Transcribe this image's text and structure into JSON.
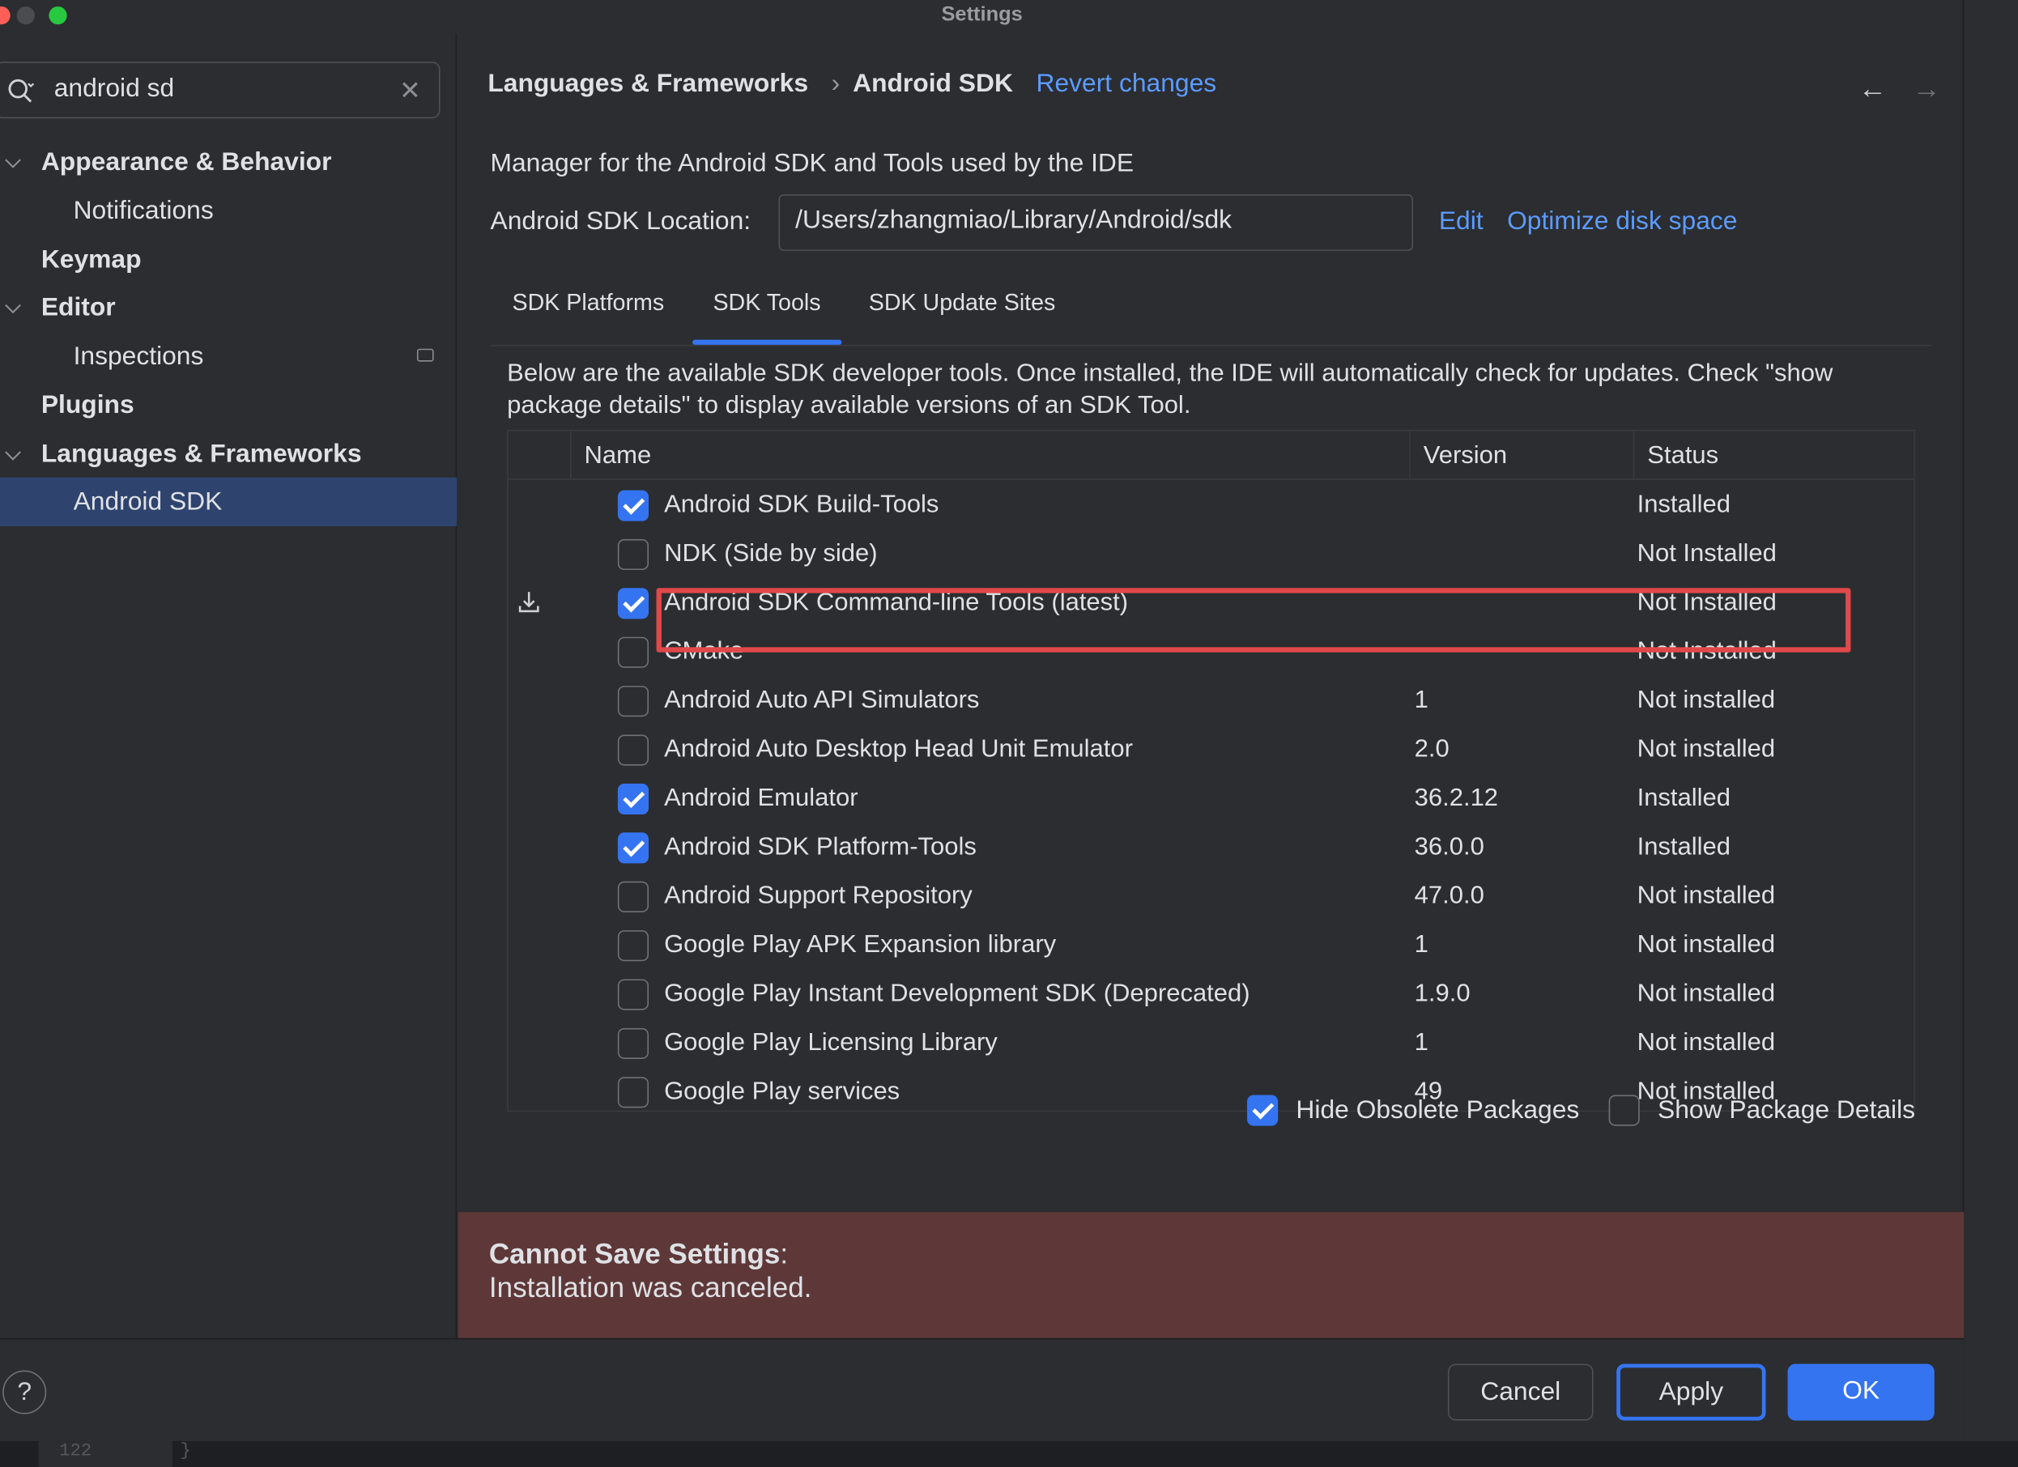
{
  "window": {
    "title": "Settings"
  },
  "search": {
    "value": "android sd",
    "icon": "search-icon",
    "clear_icon": "close-icon"
  },
  "sidebar": {
    "items": [
      {
        "label": "Appearance & Behavior",
        "level": 0,
        "expanded": true
      },
      {
        "label": "Notifications",
        "level": 1
      },
      {
        "label": "Keymap",
        "level": 0
      },
      {
        "label": "Editor",
        "level": 0,
        "expanded": true
      },
      {
        "label": "Inspections",
        "level": 1
      },
      {
        "label": "Plugins",
        "level": 0
      },
      {
        "label": "Languages & Frameworks",
        "level": 0,
        "expanded": true
      },
      {
        "label": "Android SDK",
        "level": 1,
        "selected": true
      }
    ]
  },
  "breadcrumb": {
    "parent": "Languages & Frameworks",
    "current": "Android SDK",
    "revert": "Revert changes",
    "separator": "›"
  },
  "nav": {
    "back": "←",
    "forward": "→"
  },
  "sdk": {
    "description": "Manager for the Android SDK and Tools used by the IDE",
    "location_label": "Android SDK Location:",
    "location_value": "/Users/zhangmiao/Library/Android/sdk",
    "edit": "Edit",
    "optimize": "Optimize disk space"
  },
  "tabs": [
    {
      "label": "SDK Platforms"
    },
    {
      "label": "SDK Tools",
      "active": true
    },
    {
      "label": "SDK Update Sites"
    }
  ],
  "tools_description": "Below are the available SDK developer tools. Once installed, the IDE will automatically check for updates. Check \"show package details\" to display available versions of an SDK Tool.",
  "table": {
    "headers": {
      "name": "Name",
      "version": "Version",
      "status": "Status"
    },
    "rows": [
      {
        "name": "Android SDK Build-Tools",
        "version": "",
        "status": "Installed",
        "checked": true
      },
      {
        "name": "NDK (Side by side)",
        "version": "",
        "status": "Not Installed",
        "checked": false
      },
      {
        "name": "Android SDK Command-line Tools (latest)",
        "version": "",
        "status": "Not Installed",
        "checked": true,
        "download": true
      },
      {
        "name": "CMake",
        "version": "",
        "status": "Not Installed",
        "checked": false,
        "strike": true
      },
      {
        "name": "Android Auto API Simulators",
        "version": "1",
        "status": "Not installed",
        "checked": false
      },
      {
        "name": "Android Auto Desktop Head Unit Emulator",
        "version": "2.0",
        "status": "Not installed",
        "checked": false
      },
      {
        "name": "Android Emulator",
        "version": "36.2.12",
        "status": "Installed",
        "checked": true
      },
      {
        "name": "Android SDK Platform-Tools",
        "version": "36.0.0",
        "status": "Installed",
        "checked": true
      },
      {
        "name": "Android Support Repository",
        "version": "47.0.0",
        "status": "Not installed",
        "checked": false
      },
      {
        "name": "Google Play APK Expansion library",
        "version": "1",
        "status": "Not installed",
        "checked": false
      },
      {
        "name": "Google Play Instant Development SDK (Deprecated)",
        "version": "1.9.0",
        "status": "Not installed",
        "checked": false
      },
      {
        "name": "Google Play Licensing Library",
        "version": "1",
        "status": "Not installed",
        "checked": false
      },
      {
        "name": "Google Play services",
        "version": "49",
        "status": "Not installed",
        "checked": false
      }
    ]
  },
  "options": {
    "hide_obsolete": {
      "label": "Hide Obsolete Packages",
      "checked": true
    },
    "show_details": {
      "label": "Show Package Details",
      "checked": false
    }
  },
  "error": {
    "title": "Cannot Save Settings",
    "colon": ":",
    "message": "Installation was canceled."
  },
  "footer": {
    "help": "?",
    "cancel": "Cancel",
    "apply": "Apply",
    "ok": "OK"
  },
  "editor_peek": {
    "line": "122",
    "text": "}"
  },
  "colors": {
    "accent": "#3574f0",
    "link": "#5c9bff",
    "error_bg": "#5e3838",
    "highlight": "#e0484a",
    "selected": "#2e436e"
  }
}
